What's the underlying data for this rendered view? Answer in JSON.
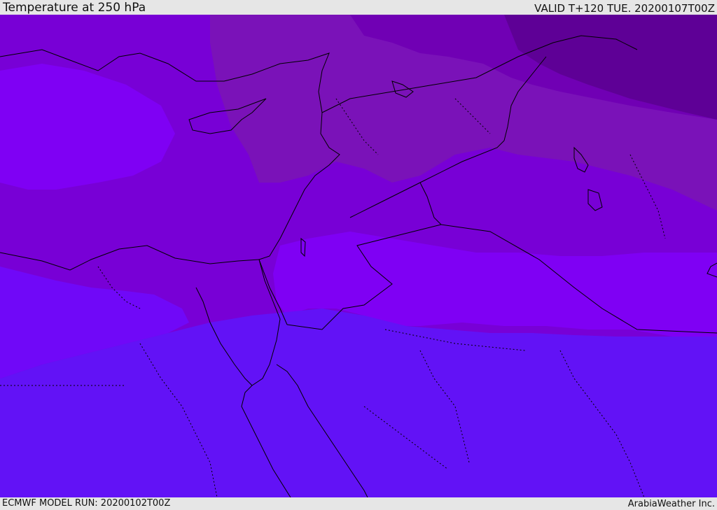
{
  "header": {
    "title": "Temperature at 250 hPa",
    "valid": "VALID T+120 TUE. 20200107T00Z"
  },
  "footer": {
    "model_run": "ECMWF MODEL RUN: 20200102T00Z",
    "credit": "ArabiaWeather Inc."
  },
  "map": {
    "colors": {
      "band_coldest": "#5e0096",
      "band_cold": "#7000b4",
      "band_mid": "#7a12b8",
      "band_warm_a": "#7800d6",
      "band_warm_b": "#7f00f4",
      "band_warm_c": "#7008f8",
      "band_warmest": "#6212f6",
      "land_outline": "#000000",
      "border": "#000000"
    }
  }
}
